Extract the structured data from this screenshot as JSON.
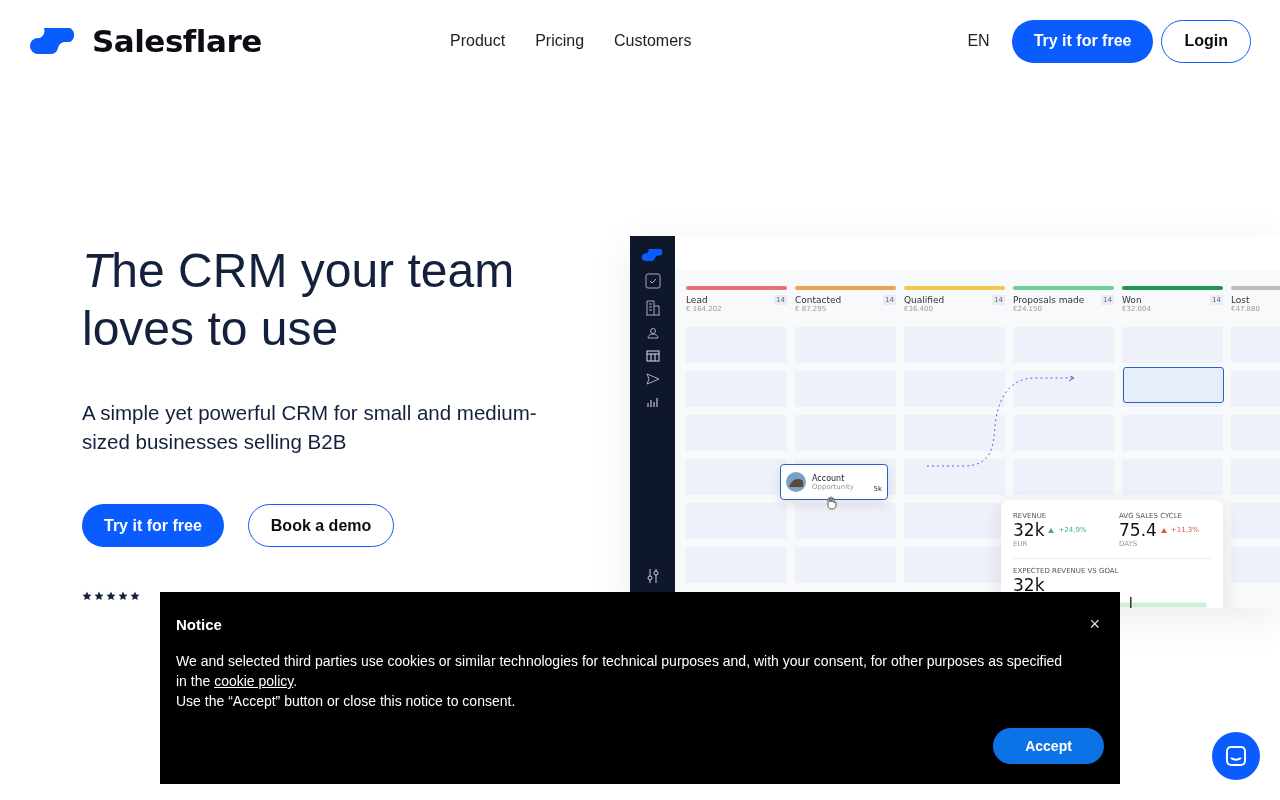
{
  "nav": {
    "brand": "Salesflare",
    "links": [
      "Product",
      "Pricing",
      "Customers"
    ],
    "language": "EN",
    "cta": "Try it for free",
    "login": "Login"
  },
  "hero": {
    "title": [
      {
        "text": "T",
        "italic": true
      },
      {
        "text": "he CRM your team loves to use",
        "italic": false
      }
    ],
    "subtitle": "A simple yet powerful CRM for small and medium-sized businesses selling B2B",
    "primary": "Try it for free",
    "secondary": "Book a demo",
    "stars": 5
  },
  "mockup": {
    "columns": [
      {
        "name": "Lead",
        "count": "14",
        "amount": "€ 164.202",
        "color": "#e57373"
      },
      {
        "name": "Contacted",
        "count": "14",
        "amount": "€ 87.295",
        "color": "#f0a050"
      },
      {
        "name": "Qualified",
        "count": "14",
        "amount": "€36.400",
        "color": "#f2c94c"
      },
      {
        "name": "Proposals made",
        "count": "14",
        "amount": "€24.150",
        "color": "#6fcf97"
      },
      {
        "name": "Won",
        "count": "14",
        "amount": "€32.004",
        "color": "#219653"
      },
      {
        "name": "Lost",
        "amount": "€47.880",
        "color": "#bdbdbd"
      }
    ],
    "card": {
      "title": "Account",
      "subtitle": "Opportunity",
      "value": "5k"
    },
    "stats": [
      {
        "label": "REVENUE",
        "value": "32k",
        "change": "+24,9%",
        "unit": "EUR",
        "color": "#3cb371"
      },
      {
        "label": "AVG SALES CYCLE",
        "value": "75.4",
        "change": "+11,3%",
        "unit": "DAYS",
        "color": "#d9534f"
      }
    ],
    "goal": {
      "label": "EXPECTED REVENUE VS GOAL",
      "value": "32k"
    }
  },
  "notice": {
    "title": "Notice",
    "before": "We and selected third parties use cookies or similar technologies for technical purposes and, with your consent, for other purposes as specified in the ",
    "link": "cookie policy",
    "after": ".",
    "line2": "Use the “Accept” button or close this notice to consent.",
    "close": "×",
    "accept": "Accept"
  }
}
